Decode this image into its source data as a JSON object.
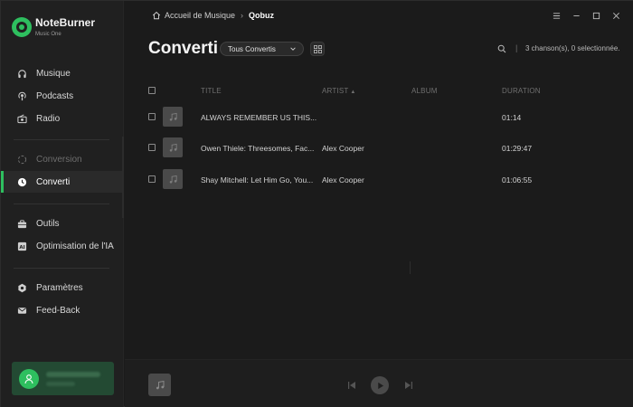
{
  "brand": {
    "name": "NoteBurner",
    "sub": "Music One"
  },
  "sidebar": {
    "items": [
      {
        "label": "Musique",
        "icon": "headphones-icon"
      },
      {
        "label": "Podcasts",
        "icon": "podcast-icon"
      },
      {
        "label": "Radio",
        "icon": "radio-icon"
      },
      {
        "label": "Conversion",
        "icon": "conversion-icon",
        "state": "disabled"
      },
      {
        "label": "Converti",
        "icon": "clock-icon",
        "state": "active"
      },
      {
        "label": "Outils",
        "icon": "toolbox-icon"
      },
      {
        "label": "Optimisation de l'IA",
        "icon": "ai-icon"
      },
      {
        "label": "Paramètres",
        "icon": "gear-icon"
      },
      {
        "label": "Feed-Back",
        "icon": "mail-icon"
      }
    ]
  },
  "breadcrumb": {
    "home": "Accueil de Musique",
    "current": "Qobuz"
  },
  "page": {
    "title": "Converti",
    "filter_value": "Tous Convertis",
    "status": "3 chanson(s), 0 selectionnée."
  },
  "table": {
    "columns": {
      "title": "TITLE",
      "artist": "ARTIST",
      "album": "ALBUM",
      "duration": "DURATION"
    },
    "rows": [
      {
        "title": "ALWAYS REMEMBER US THIS...",
        "artist": "",
        "album": "",
        "duration": "01:14"
      },
      {
        "title": "Owen Thiele: Threesomes, Fac...",
        "artist": "Alex Cooper",
        "album": "",
        "duration": "01:29:47"
      },
      {
        "title": "Shay Mitchell: Let Him Go, You...",
        "artist": "Alex Cooper",
        "album": "",
        "duration": "01:06:55"
      }
    ]
  },
  "colors": {
    "accent": "#2ebf5f",
    "background": "#1b1b1b",
    "sidebar": "#202020"
  }
}
